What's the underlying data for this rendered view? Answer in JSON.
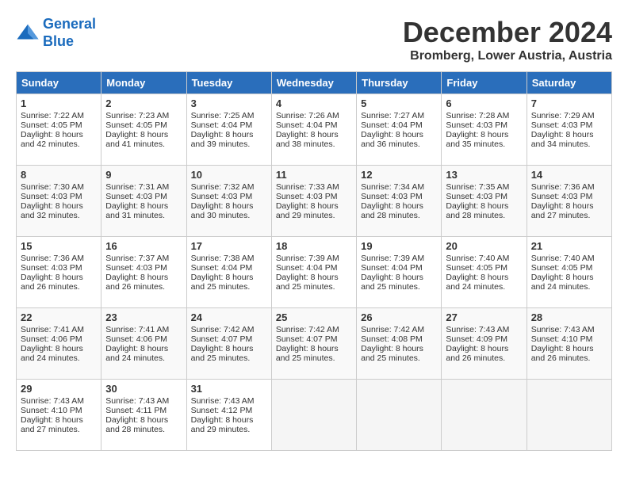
{
  "header": {
    "logo_line1": "General",
    "logo_line2": "Blue",
    "month": "December 2024",
    "location": "Bromberg, Lower Austria, Austria"
  },
  "days_of_week": [
    "Sunday",
    "Monday",
    "Tuesday",
    "Wednesday",
    "Thursday",
    "Friday",
    "Saturday"
  ],
  "weeks": [
    [
      {
        "day": 1,
        "info": "Sunrise: 7:22 AM\nSunset: 4:05 PM\nDaylight: 8 hours and 42 minutes."
      },
      {
        "day": 2,
        "info": "Sunrise: 7:23 AM\nSunset: 4:05 PM\nDaylight: 8 hours and 41 minutes."
      },
      {
        "day": 3,
        "info": "Sunrise: 7:25 AM\nSunset: 4:04 PM\nDaylight: 8 hours and 39 minutes."
      },
      {
        "day": 4,
        "info": "Sunrise: 7:26 AM\nSunset: 4:04 PM\nDaylight: 8 hours and 38 minutes."
      },
      {
        "day": 5,
        "info": "Sunrise: 7:27 AM\nSunset: 4:04 PM\nDaylight: 8 hours and 36 minutes."
      },
      {
        "day": 6,
        "info": "Sunrise: 7:28 AM\nSunset: 4:03 PM\nDaylight: 8 hours and 35 minutes."
      },
      {
        "day": 7,
        "info": "Sunrise: 7:29 AM\nSunset: 4:03 PM\nDaylight: 8 hours and 34 minutes."
      }
    ],
    [
      {
        "day": 8,
        "info": "Sunrise: 7:30 AM\nSunset: 4:03 PM\nDaylight: 8 hours and 32 minutes."
      },
      {
        "day": 9,
        "info": "Sunrise: 7:31 AM\nSunset: 4:03 PM\nDaylight: 8 hours and 31 minutes."
      },
      {
        "day": 10,
        "info": "Sunrise: 7:32 AM\nSunset: 4:03 PM\nDaylight: 8 hours and 30 minutes."
      },
      {
        "day": 11,
        "info": "Sunrise: 7:33 AM\nSunset: 4:03 PM\nDaylight: 8 hours and 29 minutes."
      },
      {
        "day": 12,
        "info": "Sunrise: 7:34 AM\nSunset: 4:03 PM\nDaylight: 8 hours and 28 minutes."
      },
      {
        "day": 13,
        "info": "Sunrise: 7:35 AM\nSunset: 4:03 PM\nDaylight: 8 hours and 28 minutes."
      },
      {
        "day": 14,
        "info": "Sunrise: 7:36 AM\nSunset: 4:03 PM\nDaylight: 8 hours and 27 minutes."
      }
    ],
    [
      {
        "day": 15,
        "info": "Sunrise: 7:36 AM\nSunset: 4:03 PM\nDaylight: 8 hours and 26 minutes."
      },
      {
        "day": 16,
        "info": "Sunrise: 7:37 AM\nSunset: 4:03 PM\nDaylight: 8 hours and 26 minutes."
      },
      {
        "day": 17,
        "info": "Sunrise: 7:38 AM\nSunset: 4:04 PM\nDaylight: 8 hours and 25 minutes."
      },
      {
        "day": 18,
        "info": "Sunrise: 7:39 AM\nSunset: 4:04 PM\nDaylight: 8 hours and 25 minutes."
      },
      {
        "day": 19,
        "info": "Sunrise: 7:39 AM\nSunset: 4:04 PM\nDaylight: 8 hours and 25 minutes."
      },
      {
        "day": 20,
        "info": "Sunrise: 7:40 AM\nSunset: 4:05 PM\nDaylight: 8 hours and 24 minutes."
      },
      {
        "day": 21,
        "info": "Sunrise: 7:40 AM\nSunset: 4:05 PM\nDaylight: 8 hours and 24 minutes."
      }
    ],
    [
      {
        "day": 22,
        "info": "Sunrise: 7:41 AM\nSunset: 4:06 PM\nDaylight: 8 hours and 24 minutes."
      },
      {
        "day": 23,
        "info": "Sunrise: 7:41 AM\nSunset: 4:06 PM\nDaylight: 8 hours and 24 minutes."
      },
      {
        "day": 24,
        "info": "Sunrise: 7:42 AM\nSunset: 4:07 PM\nDaylight: 8 hours and 25 minutes."
      },
      {
        "day": 25,
        "info": "Sunrise: 7:42 AM\nSunset: 4:07 PM\nDaylight: 8 hours and 25 minutes."
      },
      {
        "day": 26,
        "info": "Sunrise: 7:42 AM\nSunset: 4:08 PM\nDaylight: 8 hours and 25 minutes."
      },
      {
        "day": 27,
        "info": "Sunrise: 7:43 AM\nSunset: 4:09 PM\nDaylight: 8 hours and 26 minutes."
      },
      {
        "day": 28,
        "info": "Sunrise: 7:43 AM\nSunset: 4:10 PM\nDaylight: 8 hours and 26 minutes."
      }
    ],
    [
      {
        "day": 29,
        "info": "Sunrise: 7:43 AM\nSunset: 4:10 PM\nDaylight: 8 hours and 27 minutes."
      },
      {
        "day": 30,
        "info": "Sunrise: 7:43 AM\nSunset: 4:11 PM\nDaylight: 8 hours and 28 minutes."
      },
      {
        "day": 31,
        "info": "Sunrise: 7:43 AM\nSunset: 4:12 PM\nDaylight: 8 hours and 29 minutes."
      },
      null,
      null,
      null,
      null
    ]
  ]
}
